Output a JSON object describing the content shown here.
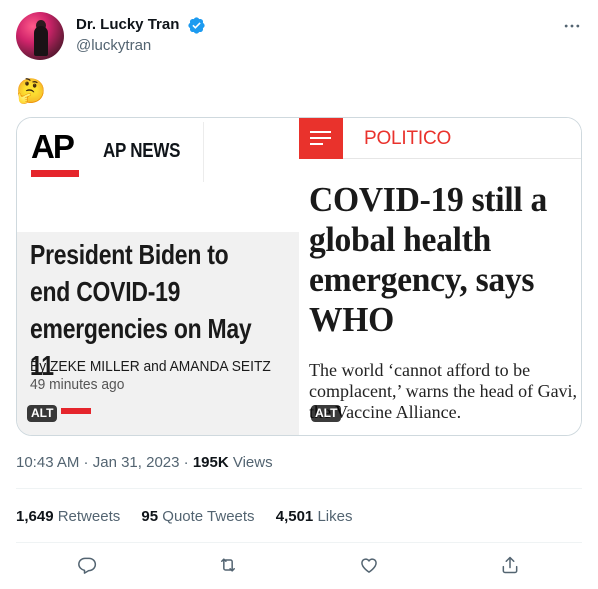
{
  "author": {
    "display_name": "Dr. Lucky Tran",
    "handle": "@luckytran",
    "more_icon": "more-icon",
    "verified_icon": "verified-badge-icon"
  },
  "tweet": {
    "text": "🤔"
  },
  "media": {
    "left": {
      "logo": "AP",
      "brand": "AP NEWS",
      "headline": "President Biden to end COVID-19 emergencies on May 11",
      "byline": "By ZEKE MILLER and AMANDA SEITZ",
      "time": "49 minutes ago",
      "alt": "ALT"
    },
    "right": {
      "brand": "POLITICO",
      "headline": "COVID-19 still a global health emergency, says WHO",
      "dek": "The world ‘cannot afford to be complacent,’ warns the head of Gavi, the Vaccine Alliance.",
      "alt": "ALT"
    }
  },
  "meta": {
    "time": "10:43 AM",
    "sep1": " · ",
    "date": "Jan 31, 2023",
    "sep2": " · ",
    "views_count": "195K",
    "views_label": " Views"
  },
  "stats": {
    "retweets_count": "1,649",
    "retweets_label": " Retweets",
    "quotes_count": "95",
    "quotes_label": " Quote Tweets",
    "likes_count": "4,501",
    "likes_label": " Likes"
  },
  "actions": [
    "reply-icon",
    "retweet-icon",
    "like-icon",
    "share-icon"
  ],
  "colors": {
    "verified": "#1d9bf0",
    "politico_red": "#e9322c",
    "ap_red": "#e5252c",
    "secondary_text": "#536471"
  }
}
